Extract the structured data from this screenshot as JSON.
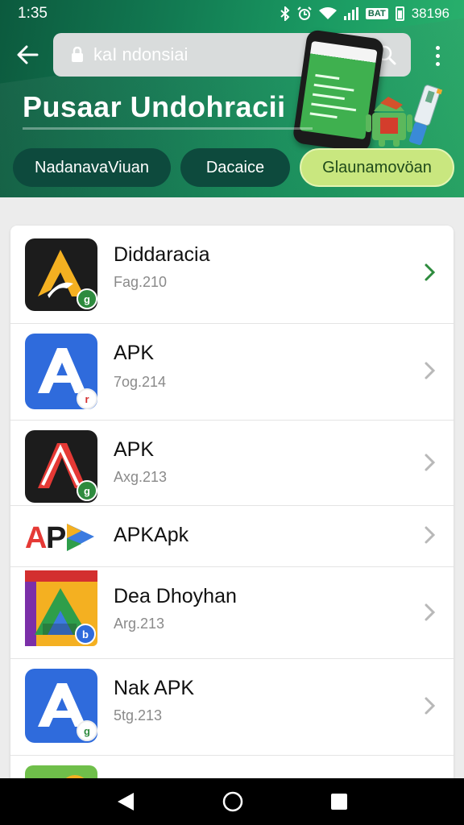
{
  "status": {
    "time": "1:35",
    "battery_label": "BAT",
    "battery_text": "38196"
  },
  "search": {
    "value": "kaI ndonsiai"
  },
  "header": {
    "title": "Pusaar Undohracii",
    "chips": [
      "NadanavaViuan",
      "Dacaice",
      "Glaunamovöan"
    ]
  },
  "apps": [
    {
      "name": "Diddaracia",
      "sub": "Fag.210",
      "badge": "g",
      "chevron_color": "#2e8b3e"
    },
    {
      "name": "APK",
      "sub": "7og.214",
      "badge": "r",
      "chevron_color": "#b8b8b8"
    },
    {
      "name": "APK",
      "sub": "Axg.213",
      "badge": "g",
      "chevron_color": "#b8b8b8"
    },
    {
      "name": "APKApk",
      "sub": "",
      "badge": "",
      "chevron_color": "#b8b8b8"
    },
    {
      "name": "Dea Dhoyhan",
      "sub": "Arg.213",
      "badge": "b",
      "chevron_color": "#b8b8b8"
    },
    {
      "name": "Nak APK",
      "sub": "5tg.213",
      "badge": "g",
      "chevron_color": "#b8b8b8"
    }
  ],
  "colors": {
    "accent_green": "#127a52",
    "chip_active": "#c9e77f",
    "chip_dark": "#0d4a3d"
  },
  "icons": [
    "back-arrow-icon",
    "lock-icon",
    "search-icon",
    "more-vert-icon",
    "nav-back-icon",
    "nav-home-icon",
    "nav-recents-icon"
  ]
}
